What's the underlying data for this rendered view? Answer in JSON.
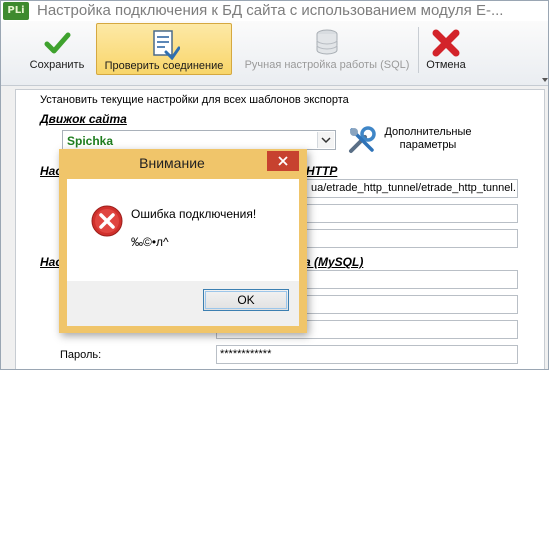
{
  "window": {
    "app_icon_text": "PLi",
    "title": "Настройка подключения к БД сайта с использованием модуля E-..."
  },
  "toolbar": {
    "save_label": "Сохранить",
    "check_label": "Проверить соединение",
    "manual_sql_label": "Ручная настройка работы (SQL)",
    "cancel_label": "Отмена"
  },
  "form": {
    "hint": "Установить текущие настройки для всех шаблонов экспорта",
    "engine_section": "Движок сайта",
    "engine_value": "Spichka",
    "more_params_label": "Дополнительные параметры",
    "section2_visible": "Нас",
    "section2_tail": "HTTP",
    "url_value": "ua/etrade_http_tunnel/etrade_http_tunnel.",
    "section3_visible": "Нас",
    "section3_tail": "а (MySQL)",
    "password_label": "Пароль:",
    "password_value": "************"
  },
  "dialog": {
    "title": "Внимание",
    "message": "Ошибка подключения!",
    "detail": "‰©•л^",
    "ok_label": "OK"
  },
  "colors": {
    "accent_active": "#f8d56a",
    "engine_text": "#1e7d1e",
    "dialog_frame": "#f0c56a",
    "close_button": "#c7422f"
  }
}
